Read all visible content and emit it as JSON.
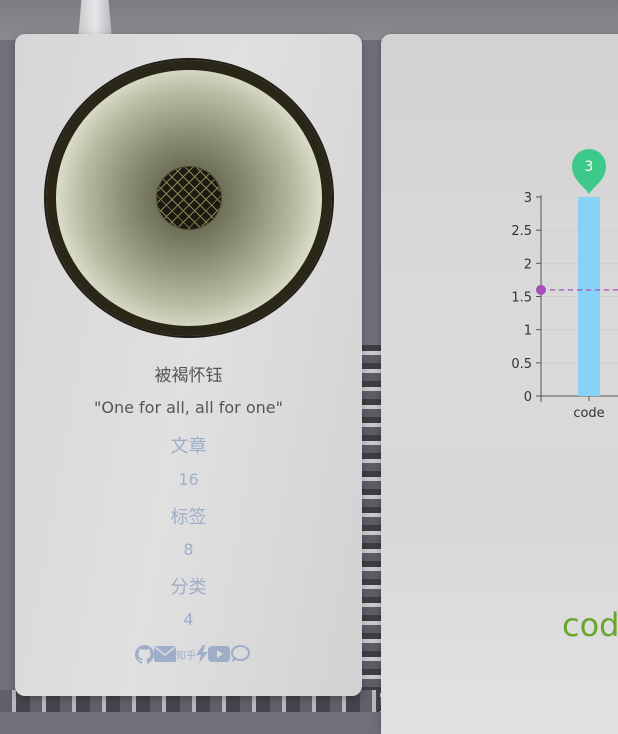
{
  "profile": {
    "author_name": "被褐怀钰",
    "motto": "\"One for all, all for one\"",
    "stats": [
      {
        "label": "文章",
        "value": "16"
      },
      {
        "label": "标签",
        "value": "8"
      },
      {
        "label": "分类",
        "value": "4"
      }
    ],
    "social": {
      "icons": [
        "github-icon",
        "mail-icon",
        "zhihu-icon",
        "bolt-icon",
        "youtube-icon",
        "chat-bubble-icon"
      ],
      "zhihu_text": "知乎"
    }
  },
  "chart_data": {
    "type": "bar",
    "categories": [
      "code"
    ],
    "series": [
      {
        "values": [
          3
        ]
      }
    ],
    "ylim": [
      0,
      3
    ],
    "yticks": [
      "0",
      "0.5",
      "1",
      "1.5",
      "2",
      "2.5",
      "3"
    ],
    "max_marker": "3",
    "average_line_value": 1.6,
    "colors": {
      "bar": "#87d3f5",
      "marker": "#3dc98a",
      "average": "#a64ebb"
    }
  },
  "chart_footer_label": "cod"
}
